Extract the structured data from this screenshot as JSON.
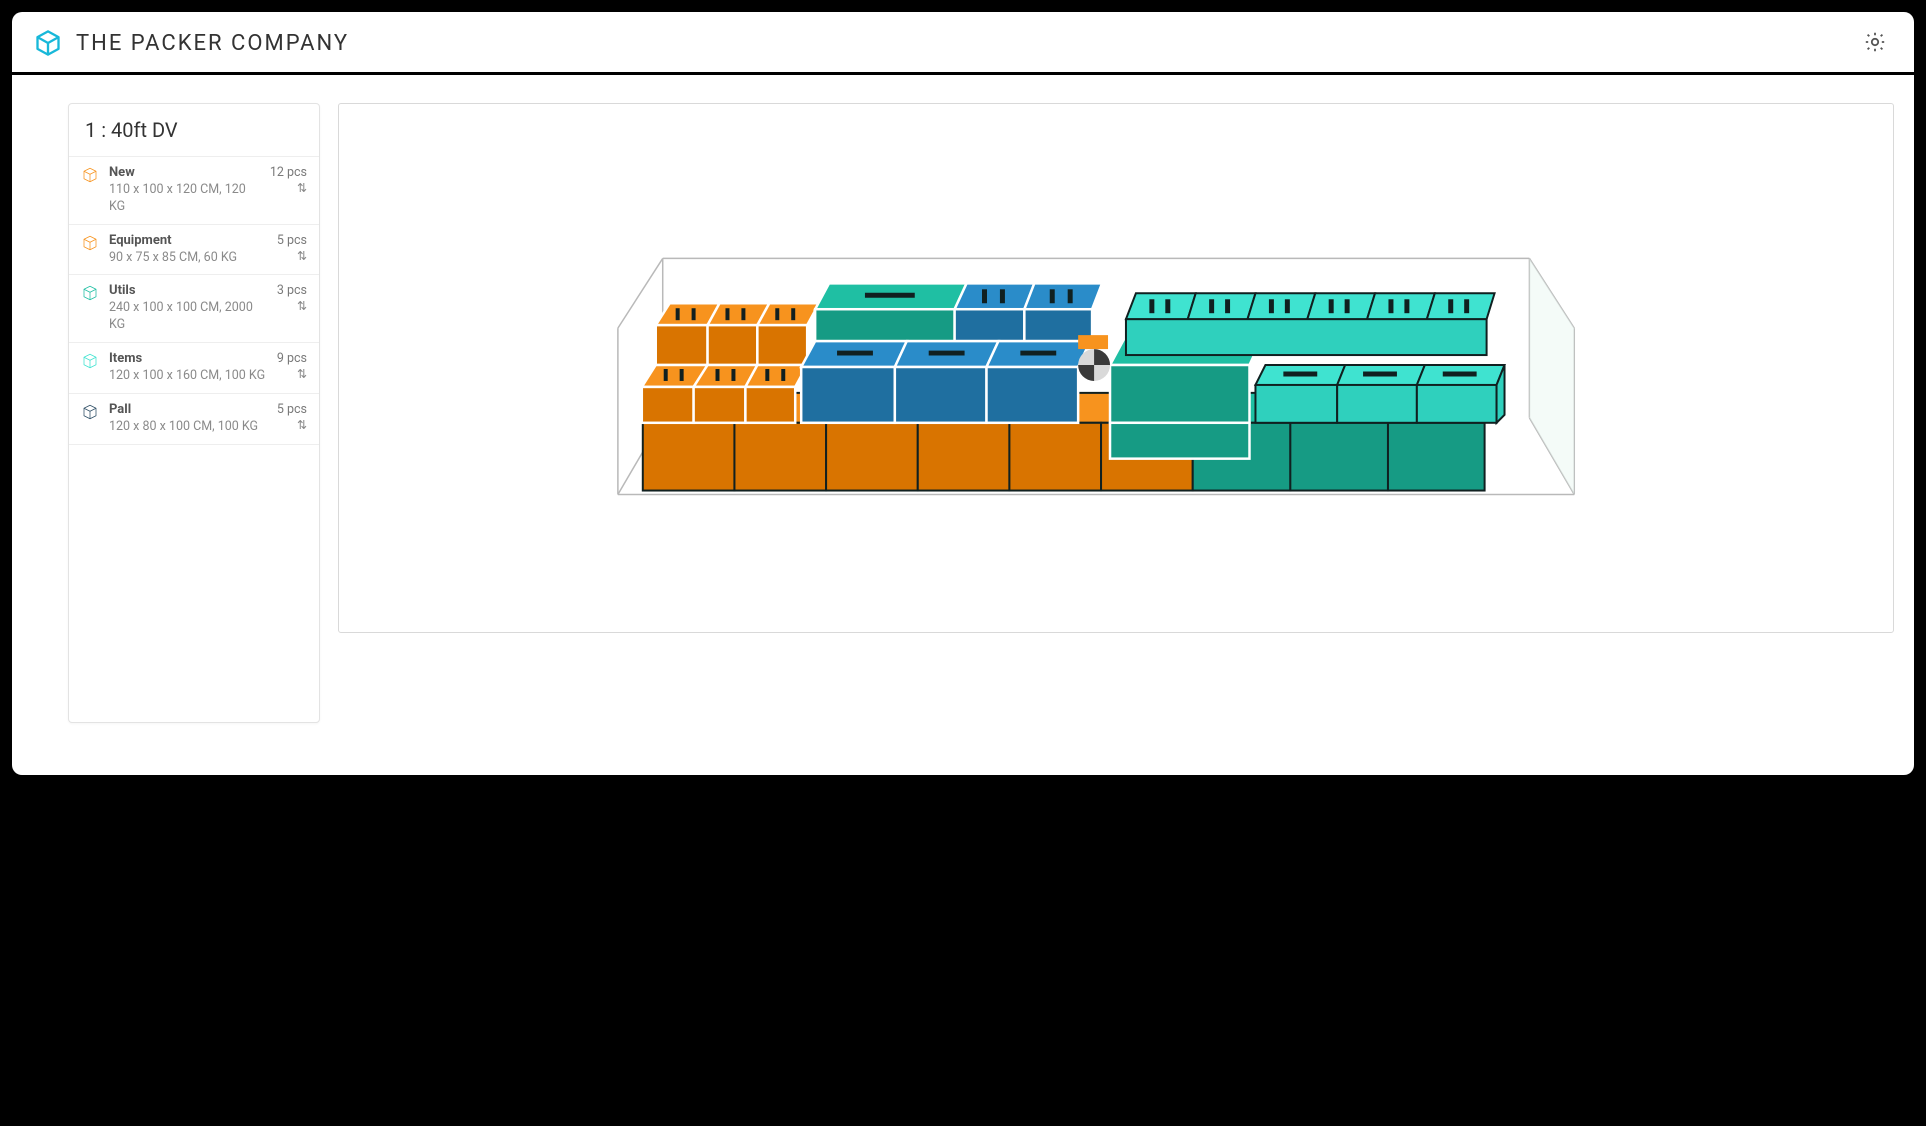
{
  "header": {
    "title": "THE PACKER COMPANY"
  },
  "sidebar": {
    "title": "1 : 40ft DV",
    "items": [
      {
        "name": "New",
        "dims": "110 x 100 x 120 CM, 120 KG",
        "count": "12 pcs",
        "color": "#f7931e"
      },
      {
        "name": "Equipment",
        "dims": "90 x 75 x 85 CM, 60 KG",
        "count": "5 pcs",
        "color": "#f7931e"
      },
      {
        "name": "Utils",
        "dims": "240 x 100 x 100 CM, 2000 KG",
        "count": "3 pcs",
        "color": "#1fbfa3"
      },
      {
        "name": "Items",
        "dims": "120 x 100 x 160 CM, 100 KG",
        "count": "9 pcs",
        "color": "#3fe3d0"
      },
      {
        "name": "Pall",
        "dims": "120 x 80 x 100 CM, 100 KG",
        "count": "5 pcs",
        "color": "#2f4f66"
      }
    ]
  },
  "container": {
    "label": "40ft DV",
    "index": 1
  },
  "boxes": [
    {
      "type": "New",
      "color": "orange",
      "qty": 12
    },
    {
      "type": "Equipment",
      "color": "orange",
      "qty": 5
    },
    {
      "type": "Utils",
      "color": "teal",
      "qty": 3
    },
    {
      "type": "Items",
      "color": "cyan",
      "qty": 9
    },
    {
      "type": "Pall",
      "color": "navy",
      "qty": 5
    }
  ]
}
